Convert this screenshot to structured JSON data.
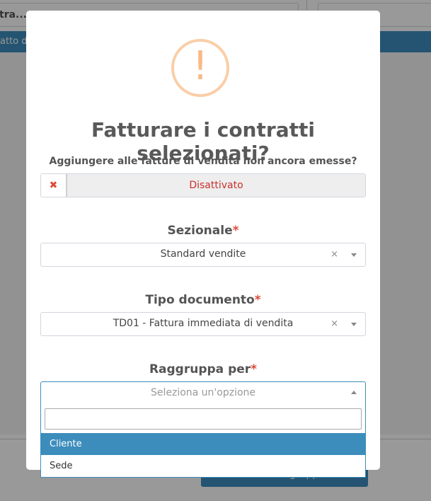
{
  "background": {
    "input_text": "tra...",
    "bar_text": "atto d",
    "footer_button": "Azioni di gruppo"
  },
  "modal": {
    "icon_symbol": "!",
    "title": "Fatturare i contratti selezionati?",
    "append_label": "Aggiungere alle fatture di vendita non ancora emesse?",
    "toggle_icon": "✖",
    "toggle_state": "Disattivato",
    "sezionale": {
      "label": "Sezionale",
      "required_mark": "*",
      "value": "Standard vendite",
      "clear": "×"
    },
    "tipo_documento": {
      "label": "Tipo documento",
      "required_mark": "*",
      "value": "TD01 - Fattura immediata di vendita",
      "clear": "×"
    },
    "raggruppa": {
      "label": "Raggruppa per",
      "required_mark": "*",
      "placeholder": "Seleziona un'opzione",
      "search_value": "",
      "options": [
        "Cliente",
        "Sede"
      ],
      "highlighted": "Cliente"
    }
  },
  "colors": {
    "accent": "#3c8dbc",
    "required": "#dd4b39",
    "warning": "#f8bb86"
  }
}
